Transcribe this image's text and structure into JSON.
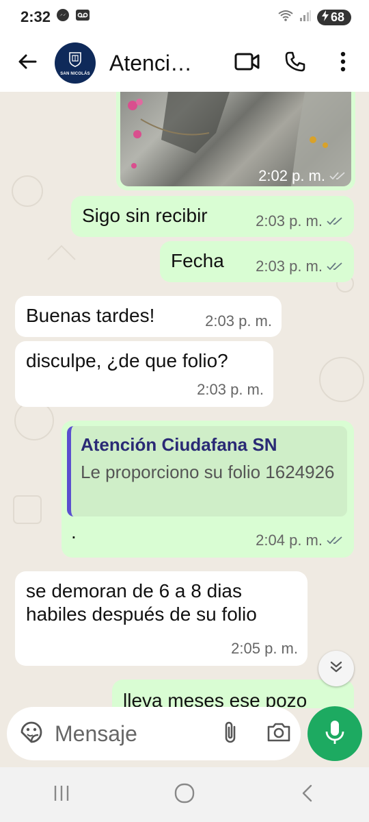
{
  "status_bar": {
    "time": "2:32",
    "battery_level": "68",
    "icons": [
      "messenger-icon",
      "voicemail-icon",
      "wifi-icon",
      "signal-icon",
      "battery-charging-icon"
    ]
  },
  "header": {
    "contact_name": "Atenci…",
    "avatar_text": "SAN NICOLÁS",
    "back_icon": "arrow-left-icon",
    "video_icon": "video-call-icon",
    "call_icon": "phone-icon",
    "menu_icon": "more-vert-icon"
  },
  "messages": [
    {
      "direction": "out",
      "type": "image",
      "time": "2:02 p. m.",
      "status": "delivered"
    },
    {
      "direction": "out",
      "text": "Sigo sin recibir",
      "time": "2:03 p. m.",
      "status": "read"
    },
    {
      "direction": "out",
      "text": "Fecha",
      "time": "2:03 p. m.",
      "status": "read"
    },
    {
      "direction": "in",
      "text": "Buenas tardes!",
      "time": "2:03 p. m."
    },
    {
      "direction": "in",
      "text": "disculpe, ¿de que folio?",
      "time": "2:03 p. m."
    },
    {
      "direction": "out",
      "quote_author": "Atención Ciudafana SN",
      "quote_text": "Le proporciono su folio 1624926",
      "text": ".",
      "time": "2:04 p. m.",
      "status": "read"
    },
    {
      "direction": "in",
      "text": "se demoran de 6 a 8 dias habiles después de su folio",
      "time": "2:05 p. m."
    },
    {
      "direction": "out",
      "text": "lleva meses ese pozo"
    }
  ],
  "composer": {
    "placeholder": "Mensaje",
    "emoji_icon": "sticker-icon",
    "attach_icon": "paperclip-icon",
    "camera_icon": "camera-icon",
    "mic_icon": "mic-icon"
  },
  "colors": {
    "outgoing_bubble": "#d9fdd3",
    "incoming_bubble": "#ffffff",
    "accent_green": "#1daa61",
    "read_ticks": "#667781",
    "quote_bar": "#5a4fcf"
  },
  "nav": {
    "icons": [
      "recent-apps-icon",
      "home-icon",
      "back-nav-icon"
    ]
  }
}
